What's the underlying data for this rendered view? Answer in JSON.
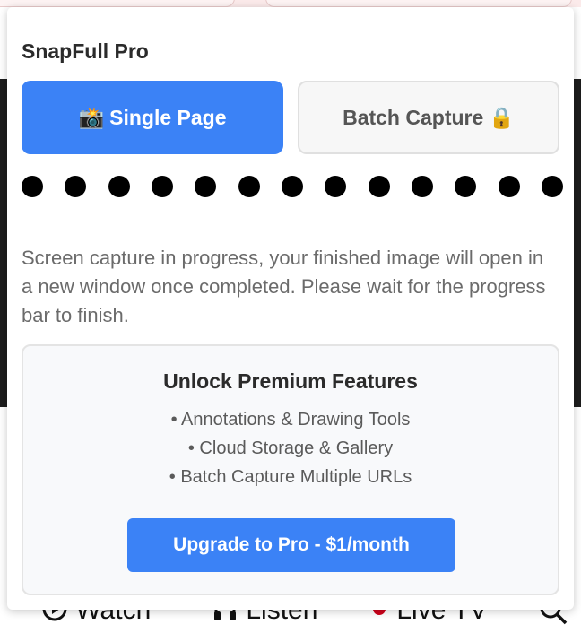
{
  "background_page": {
    "nav": [
      {
        "icon": "play-circle-icon",
        "label": "Watch"
      },
      {
        "icon": "headphones-icon",
        "label": "Listen"
      },
      {
        "icon": "live-dot-icon",
        "label": "Live TV"
      },
      {
        "icon": "search-icon",
        "label": ""
      }
    ]
  },
  "popup": {
    "title": "SnapFull Pro",
    "modes": {
      "single": {
        "icon": "📸",
        "label": "Single Page",
        "selected": true
      },
      "batch": {
        "label": "Batch Capture",
        "icon": "🔒",
        "locked": true
      }
    },
    "progress_dots": 13,
    "status_text": "Screen capture in progress, your finished image will open in a new window once completed. Please wait for the progress bar to finish.",
    "premium": {
      "title": "Unlock Premium Features",
      "features": [
        "• Annotations & Drawing Tools",
        "• Cloud Storage & Gallery",
        "• Batch Capture Multiple URLs"
      ],
      "cta": "Upgrade to Pro - $1/month"
    }
  },
  "colors": {
    "accent": "#3b82f6",
    "text_dark": "#2b2b2b",
    "text_muted": "#6b6b6b",
    "live_red": "#d0021b"
  }
}
